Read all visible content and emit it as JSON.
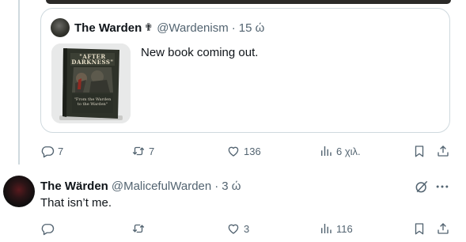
{
  "quoted_tweet": {
    "author_name": "The Warden",
    "badge_glyph": "✟",
    "handle": "@Wardenism",
    "separator": "·",
    "time": "15 ώ",
    "text": "New book coming out.",
    "image": {
      "description_icon": "book-cover-image",
      "cover_title": "\"AFTER DARKNESS\"",
      "cover_subtitle": "\"From the Warden to the Warden\""
    }
  },
  "main_actions": {
    "replies": "7",
    "reposts": "7",
    "likes": "136",
    "views": "6 χιλ."
  },
  "reply_tweet": {
    "author_name": "The Wärden",
    "handle": "@MalicefulWarden",
    "separator": "·",
    "time": "3 ώ",
    "text": "That isn’t me."
  },
  "reply_actions": {
    "replies": "",
    "reposts": "",
    "likes": "3",
    "views": "116"
  },
  "colors": {
    "text_primary": "#0f1419",
    "text_secondary": "#536471",
    "border": "#cfd9de"
  },
  "icons": [
    "reply-icon",
    "repost-icon",
    "like-icon",
    "views-icon",
    "bookmark-icon",
    "share-icon",
    "grok-icon",
    "more-icon"
  ]
}
